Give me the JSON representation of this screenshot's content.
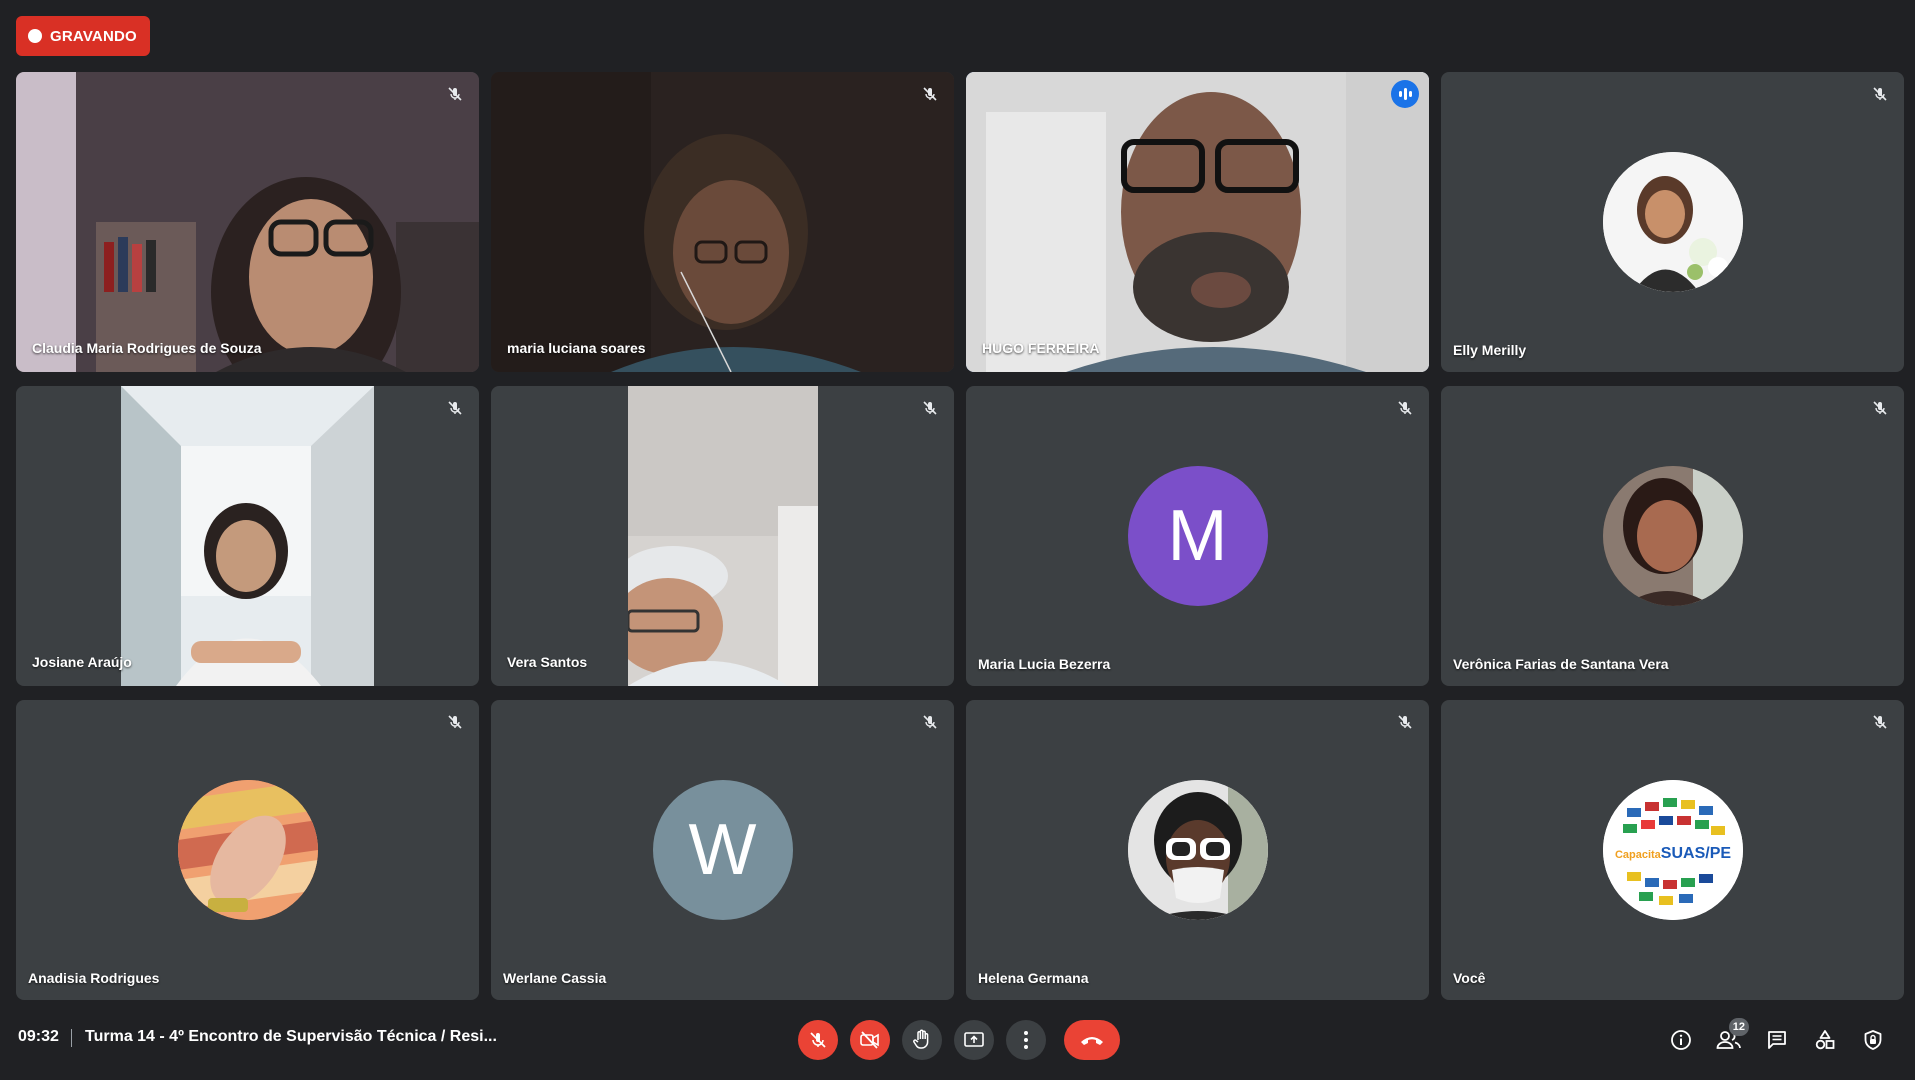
{
  "recording": {
    "label": "GRAVANDO",
    "color": "#d93025"
  },
  "participants": [
    {
      "name": "Claudia Maria Rodrigues de Souza",
      "mic": "muted",
      "media": "video"
    },
    {
      "name": "maria luciana soares",
      "mic": "muted",
      "media": "video"
    },
    {
      "name": "HUGO FERREIRA",
      "mic": "speaking",
      "media": "video"
    },
    {
      "name": "Elly Merilly",
      "mic": "muted",
      "media": "profile-photo"
    },
    {
      "name": "Josiane Araújo",
      "mic": "muted",
      "media": "video"
    },
    {
      "name": "Vera Santos",
      "mic": "muted",
      "media": "video"
    },
    {
      "name": "Maria Lucia Bezerra",
      "mic": "muted",
      "media": "initial",
      "initial": "M",
      "avatar_color": "#7b4fc9"
    },
    {
      "name": "Verônica Farias de Santana Vera",
      "mic": "muted",
      "media": "profile-photo"
    },
    {
      "name": "Anadisia Rodrigues",
      "mic": "muted",
      "media": "profile-photo"
    },
    {
      "name": "Werlane Cassia",
      "mic": "muted",
      "media": "initial",
      "initial": "W",
      "avatar_color": "#78909c"
    },
    {
      "name": "Helena Germana",
      "mic": "muted",
      "media": "profile-photo"
    },
    {
      "name": "Você",
      "mic": "muted",
      "media": "profile-photo",
      "avatar_text": "CapacitaSUAS/PE"
    }
  ],
  "bottom_bar": {
    "time": "09:32",
    "meeting_title": "Turma 14 - 4º Encontro de Supervisão Técnica / Resi...",
    "controls": [
      "mic-off",
      "camera-off",
      "raise-hand",
      "present-screen",
      "more-options",
      "leave-call"
    ],
    "right_controls": [
      "meeting-details",
      "people",
      "chat",
      "activities",
      "host-controls"
    ],
    "participant_count": "12"
  },
  "colors": {
    "background": "#202124",
    "tile": "#3c4043",
    "speaking_border": "#8ab4f8",
    "danger": "#ea4335",
    "accent": "#1a73e8"
  }
}
